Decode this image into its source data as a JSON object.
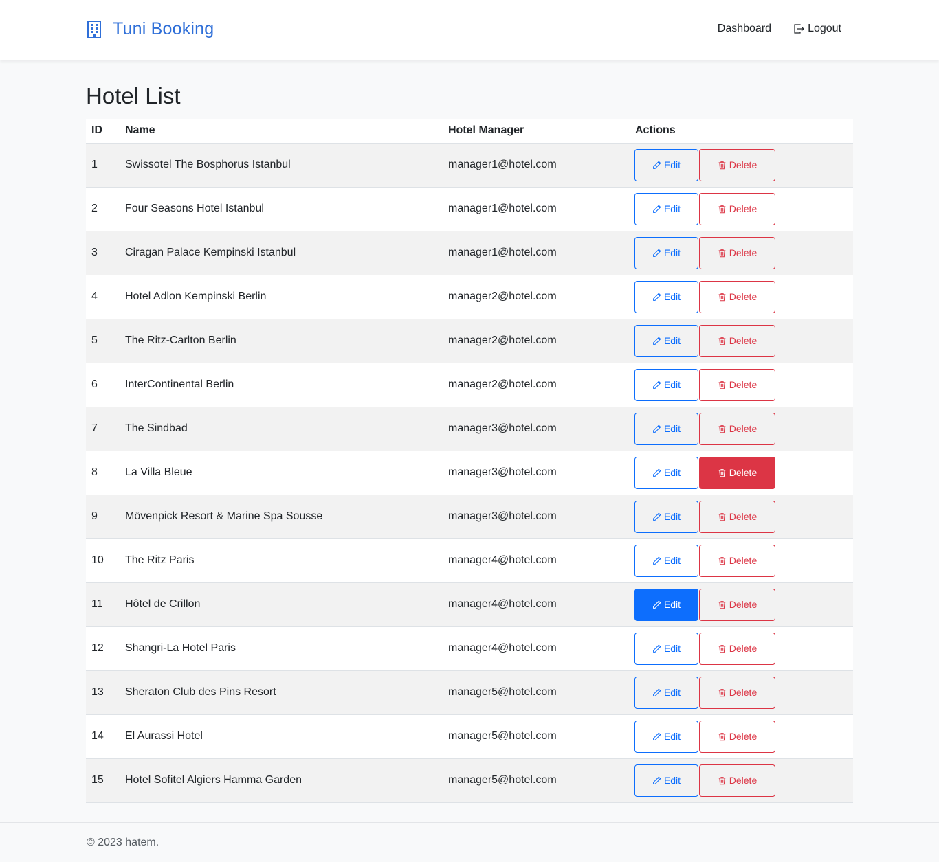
{
  "nav": {
    "brand": "Tuni Booking",
    "brand_icon": "building-icon",
    "links": [
      {
        "label": "Dashboard"
      },
      {
        "label": "Logout",
        "icon": "logout-icon"
      }
    ]
  },
  "page": {
    "title": "Hotel List"
  },
  "table": {
    "headers": [
      "ID",
      "Name",
      "Hotel Manager",
      "Actions"
    ],
    "edit_label": "Edit",
    "delete_label": "Delete",
    "rows": [
      {
        "id": "1",
        "name": "Swissotel The Bosphorus Istanbul",
        "manager": "manager1@hotel.com"
      },
      {
        "id": "2",
        "name": "Four Seasons Hotel Istanbul",
        "manager": "manager1@hotel.com"
      },
      {
        "id": "3",
        "name": "Ciragan Palace Kempinski Istanbul",
        "manager": "manager1@hotel.com"
      },
      {
        "id": "4",
        "name": "Hotel Adlon Kempinski Berlin",
        "manager": "manager2@hotel.com"
      },
      {
        "id": "5",
        "name": "The Ritz-Carlton Berlin",
        "manager": "manager2@hotel.com"
      },
      {
        "id": "6",
        "name": "InterContinental Berlin",
        "manager": "manager2@hotel.com"
      },
      {
        "id": "7",
        "name": "The Sindbad",
        "manager": "manager3@hotel.com"
      },
      {
        "id": "8",
        "name": "La Villa Bleue",
        "manager": "manager3@hotel.com",
        "hover": "delete"
      },
      {
        "id": "9",
        "name": "Mövenpick Resort & Marine Spa Sousse",
        "manager": "manager3@hotel.com"
      },
      {
        "id": "10",
        "name": "The Ritz Paris",
        "manager": "manager4@hotel.com"
      },
      {
        "id": "11",
        "name": "Hôtel de Crillon",
        "manager": "manager4@hotel.com",
        "hover": "edit"
      },
      {
        "id": "12",
        "name": "Shangri-La Hotel Paris",
        "manager": "manager4@hotel.com"
      },
      {
        "id": "13",
        "name": "Sheraton Club des Pins Resort",
        "manager": "manager5@hotel.com"
      },
      {
        "id": "14",
        "name": "El Aurassi Hotel",
        "manager": "manager5@hotel.com"
      },
      {
        "id": "15",
        "name": "Hotel Sofitel Algiers Hamma Garden",
        "manager": "manager5@hotel.com"
      }
    ]
  },
  "footer": {
    "text": "© 2023 hatem."
  },
  "colors": {
    "primary": "#0d6efd",
    "danger": "#dc3545",
    "brand": "#2f6fd8"
  }
}
